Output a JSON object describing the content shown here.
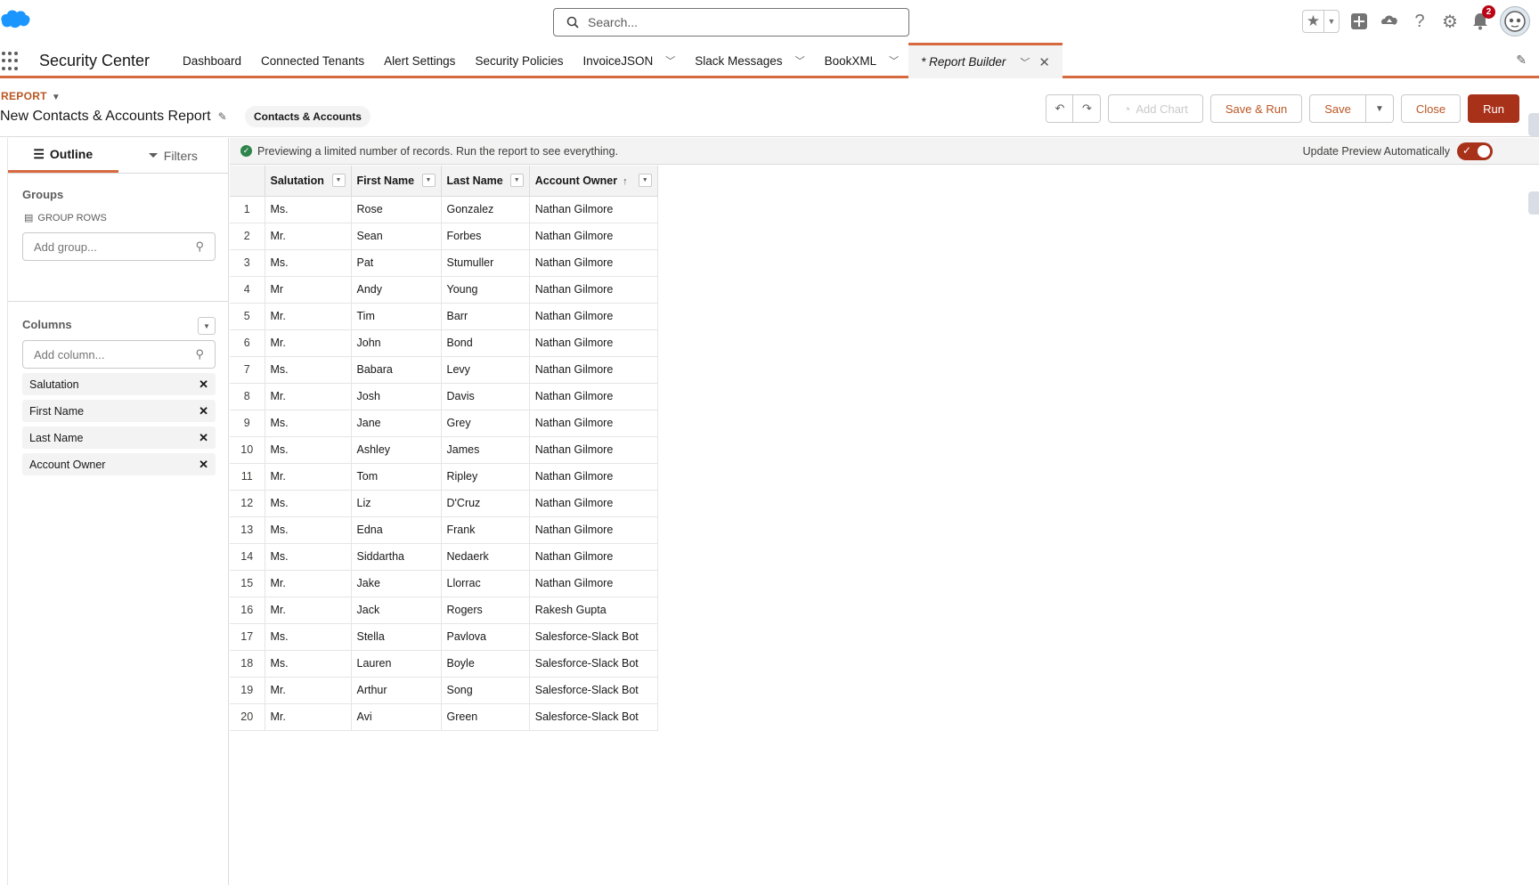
{
  "colors": {
    "accent": "#d7693f",
    "run_button": "#a8311a",
    "brand_cloud": "#1b96ff"
  },
  "header": {
    "search_placeholder": "Search...",
    "notification_count": "2"
  },
  "nav": {
    "app_name": "Security Center",
    "tabs": [
      {
        "label": "Dashboard"
      },
      {
        "label": "Connected Tenants"
      },
      {
        "label": "Alert Settings"
      },
      {
        "label": "Security Policies"
      },
      {
        "label": "InvoiceJSON"
      },
      {
        "label": "Slack Messages"
      },
      {
        "label": "BookXML"
      }
    ],
    "active_tab": "* Report Builder"
  },
  "report": {
    "type_label": "REPORT",
    "title": "New Contacts & Accounts Report",
    "report_type_pill": "Contacts & Accounts",
    "actions": {
      "add_chart": "Add Chart",
      "save_run": "Save & Run",
      "save": "Save",
      "close": "Close",
      "run": "Run"
    }
  },
  "left_panel": {
    "tabs": {
      "outline": "Outline",
      "filters": "Filters"
    },
    "groups_title": "Groups",
    "group_rows_label": "GROUP ROWS",
    "add_group_placeholder": "Add group...",
    "columns_title": "Columns",
    "add_column_placeholder": "Add column...",
    "columns": [
      "Salutation",
      "First Name",
      "Last Name",
      "Account Owner"
    ]
  },
  "preview": {
    "notice": "Previewing a limited number of records. Run the report to see everything.",
    "auto_update_label": "Update Preview Automatically",
    "auto_update_on": true,
    "headers": [
      "Salutation",
      "First Name",
      "Last Name",
      "Account Owner"
    ],
    "sorted_column": "Account Owner",
    "rows": [
      [
        "1",
        "Ms.",
        "Rose",
        "Gonzalez",
        "Nathan Gilmore"
      ],
      [
        "2",
        "Mr.",
        "Sean",
        "Forbes",
        "Nathan Gilmore"
      ],
      [
        "3",
        "Ms.",
        "Pat",
        "Stumuller",
        "Nathan Gilmore"
      ],
      [
        "4",
        "Mr",
        "Andy",
        "Young",
        "Nathan Gilmore"
      ],
      [
        "5",
        "Mr.",
        "Tim",
        "Barr",
        "Nathan Gilmore"
      ],
      [
        "6",
        "Mr.",
        "John",
        "Bond",
        "Nathan Gilmore"
      ],
      [
        "7",
        "Ms.",
        "Babara",
        "Levy",
        "Nathan Gilmore"
      ],
      [
        "8",
        "Mr.",
        "Josh",
        "Davis",
        "Nathan Gilmore"
      ],
      [
        "9",
        "Ms.",
        "Jane",
        "Grey",
        "Nathan Gilmore"
      ],
      [
        "10",
        "Ms.",
        "Ashley",
        "James",
        "Nathan Gilmore"
      ],
      [
        "11",
        "Mr.",
        "Tom",
        "Ripley",
        "Nathan Gilmore"
      ],
      [
        "12",
        "Ms.",
        "Liz",
        "D'Cruz",
        "Nathan Gilmore"
      ],
      [
        "13",
        "Ms.",
        "Edna",
        "Frank",
        "Nathan Gilmore"
      ],
      [
        "14",
        "Ms.",
        "Siddartha",
        "Nedaerk",
        "Nathan Gilmore"
      ],
      [
        "15",
        "Mr.",
        "Jake",
        "Llorrac",
        "Nathan Gilmore"
      ],
      [
        "16",
        "Mr.",
        "Jack",
        "Rogers",
        "Rakesh Gupta"
      ],
      [
        "17",
        "Ms.",
        "Stella",
        "Pavlova",
        "Salesforce-Slack Bot"
      ],
      [
        "18",
        "Ms.",
        "Lauren",
        "Boyle",
        "Salesforce-Slack Bot"
      ],
      [
        "19",
        "Mr.",
        "Arthur",
        "Song",
        "Salesforce-Slack Bot"
      ],
      [
        "20",
        "Mr.",
        "Avi",
        "Green",
        "Salesforce-Slack Bot"
      ]
    ]
  }
}
